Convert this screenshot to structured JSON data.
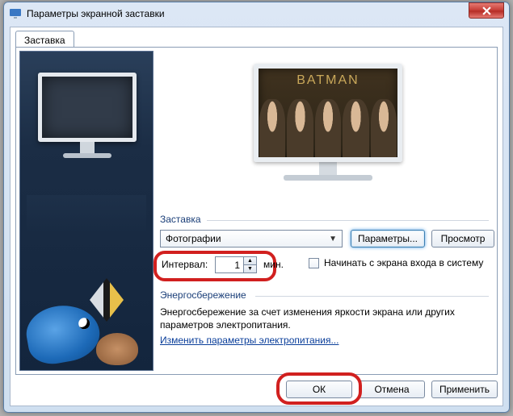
{
  "window": {
    "title": "Параметры экранной заставки"
  },
  "tab": {
    "label": "Заставка"
  },
  "preview": {
    "movie_title": "BATMAN"
  },
  "screensaver": {
    "group_label": "Заставка",
    "selected": "Фотографии",
    "params_btn": "Параметры...",
    "preview_btn": "Просмотр",
    "interval_label": "Интервал:",
    "interval_value": "1",
    "interval_unit": "мин.",
    "checkbox_label": "Начинать с экрана входа в систему"
  },
  "energy": {
    "group_label": "Энергосбережение",
    "text": "Энергосбережение за счет изменения яркости экрана или других параметров электропитания.",
    "link": "Изменить параметры электропитания..."
  },
  "footer": {
    "ok": "ОК",
    "cancel": "Отмена",
    "apply": "Применить"
  }
}
